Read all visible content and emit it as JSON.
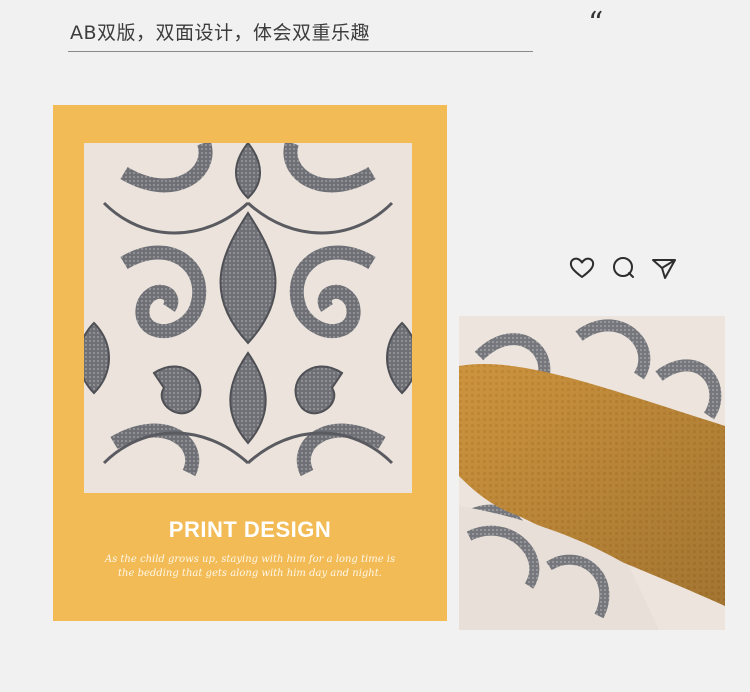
{
  "header": {
    "title": "AB双版，双面设计，体会双重乐趣",
    "quote_glyph": "“"
  },
  "card": {
    "title": "PRINT DESIGN",
    "caption_line1": "As the child grows up, staying with him for a long time is",
    "caption_line2": "the bedding that gets along with him day and night."
  },
  "social": {
    "icons": [
      "heart-icon",
      "comment-icon",
      "send-icon"
    ]
  },
  "colors": {
    "card_background": "#f2bb55",
    "page_background": "#f1f1f1",
    "pattern_cream": "#ece4dd",
    "pattern_gray": "#7b7b80",
    "quilt_orange": "#d99b3f"
  }
}
